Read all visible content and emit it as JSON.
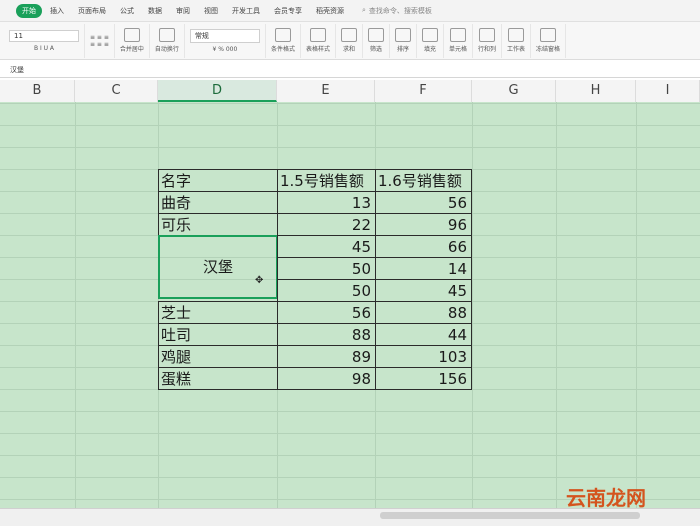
{
  "ribbon": {
    "tabs": [
      "开始",
      "插入",
      "页面布局",
      "公式",
      "数据",
      "审阅",
      "视图",
      "开发工具",
      "会员专享",
      "稻壳资源"
    ],
    "search_text": "查找命令、搜索模板"
  },
  "toolbar": {
    "font_size": "11",
    "number_format": "常规",
    "merge_label": "合并居中",
    "wrap_label": "自动换行",
    "cond_label": "条件格式",
    "style_label": "表格样式",
    "sum_label": "求和",
    "filter_label": "筛选",
    "sort_label": "排序",
    "fill_label": "填充",
    "cell_label": "单元格",
    "rowcol_label": "行和列",
    "sheet_label": "工作表",
    "freeze_label": "冻结窗格"
  },
  "formula": {
    "content": "汉堡"
  },
  "columns": [
    {
      "label": "B"
    },
    {
      "label": "C"
    },
    {
      "label": "D",
      "selected": true
    },
    {
      "label": "E"
    },
    {
      "label": "F"
    },
    {
      "label": "G"
    },
    {
      "label": "H"
    },
    {
      "label": "I"
    }
  ],
  "table": {
    "headers": [
      "名字",
      "1.5号销售额",
      "1.6号销售额"
    ],
    "rows": [
      {
        "name": "曲奇",
        "d15": "13",
        "d16": "56"
      },
      {
        "name": "可乐",
        "d15": "22",
        "d16": "96"
      },
      {
        "name": "汉堡",
        "d15": "45",
        "d16": "66"
      },
      {
        "name": "",
        "d15": "50",
        "d16": "14"
      },
      {
        "name": "",
        "d15": "50",
        "d16": "45"
      },
      {
        "name": "芝士",
        "d15": "56",
        "d16": "88"
      },
      {
        "name": "吐司",
        "d15": "88",
        "d16": "44"
      },
      {
        "name": "鸡腿",
        "d15": "89",
        "d16": "103"
      },
      {
        "name": "蛋糕",
        "d15": "98",
        "d16": "156"
      }
    ]
  },
  "watermark": "云南龙网",
  "colors": {
    "accent": "#1aa05a",
    "sheet_bg": "#c7e5cb"
  }
}
